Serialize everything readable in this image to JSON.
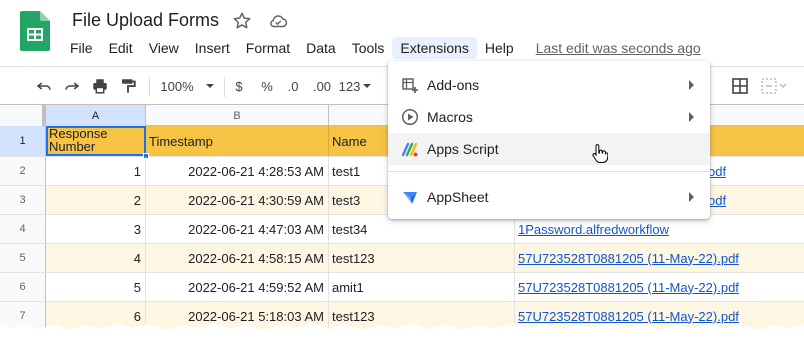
{
  "app": {
    "doc_title": "File Upload Forms",
    "menu": [
      "File",
      "Edit",
      "View",
      "Insert",
      "Format",
      "Data",
      "Tools",
      "Extensions",
      "Help"
    ],
    "active_menu": "Extensions",
    "last_edit": "Last edit was seconds ago"
  },
  "toolbar": {
    "zoom": "100%",
    "currency": "$",
    "percent": "%",
    "decrease_decimals": ".0",
    "increase_decimals": ".00",
    "more_formats": "123"
  },
  "grid": {
    "columns": [
      "A",
      "B"
    ],
    "row_numbers": [
      "1",
      "2",
      "3",
      "4",
      "5",
      "6",
      "7"
    ],
    "header": {
      "a": "Response Number",
      "b": "Timestamp",
      "c": "Name"
    },
    "rows": [
      {
        "num": "1",
        "timestamp": "2022-06-21 4:28:53 AM",
        "name": "test1",
        "file": "odf"
      },
      {
        "num": "2",
        "timestamp": "2022-06-21 4:30:59 AM",
        "name": "test3",
        "file": "odf"
      },
      {
        "num": "3",
        "timestamp": "2022-06-21 4:47:03 AM",
        "name": "test34",
        "file": "1Password.alfredworkflow"
      },
      {
        "num": "4",
        "timestamp": "2022-06-21 4:58:15 AM",
        "name": "test123",
        "file": "57U723528T0881205 (11-May-22).pdf"
      },
      {
        "num": "5",
        "timestamp": "2022-06-21 4:59:52 AM",
        "name": "amit1",
        "file": "57U723528T0881205 (11-May-22).pdf"
      },
      {
        "num": "6",
        "timestamp": "2022-06-21 5:18:03 AM",
        "name": "test123",
        "file": "57U723528T0881205 (11-May-22).pdf"
      }
    ]
  },
  "extensions_menu": {
    "items": [
      {
        "label": "Add-ons",
        "icon": "addons-icon",
        "submenu": true
      },
      {
        "label": "Macros",
        "icon": "play-circle-icon",
        "submenu": true
      },
      {
        "label": "Apps Script",
        "icon": "apps-script-icon",
        "submenu": false
      },
      {
        "label": "AppSheet",
        "icon": "appsheet-icon",
        "submenu": true
      }
    ]
  },
  "colors": {
    "header_fill": "#f6c344",
    "stripe_fill": "#fdf6e2",
    "link": "#1155cc",
    "selection": "#1a73e8",
    "sheets_green": "#23a566"
  }
}
